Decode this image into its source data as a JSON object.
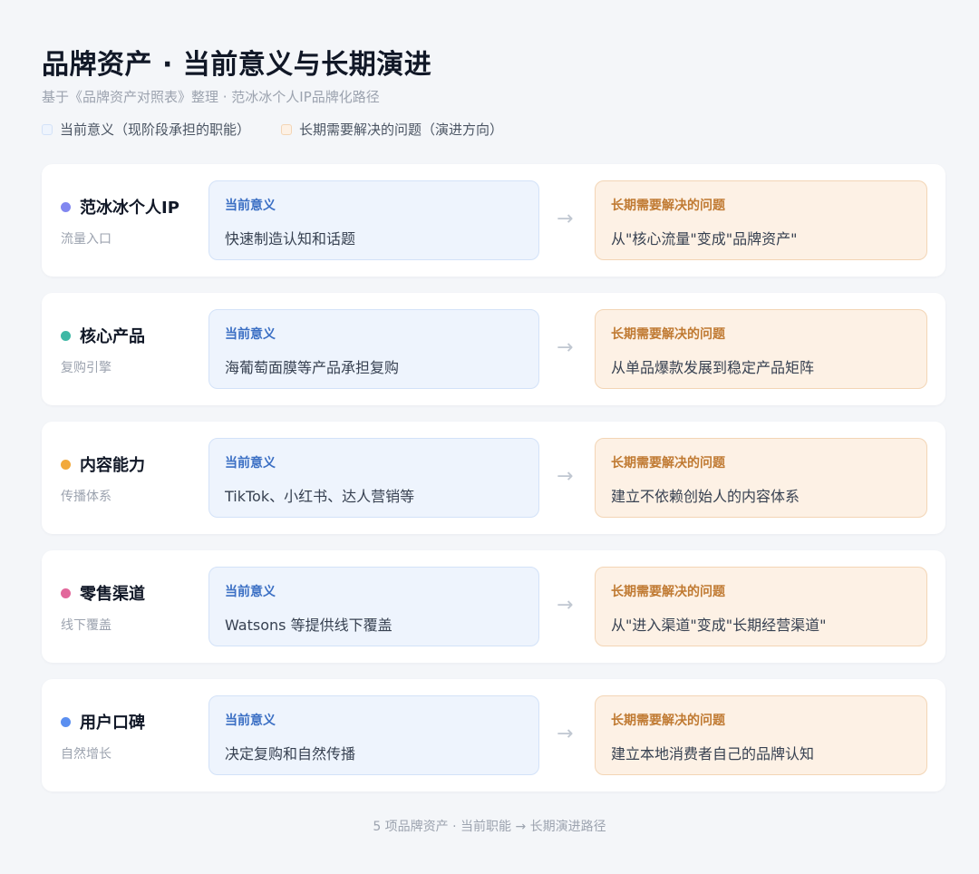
{
  "header": {
    "title": "品牌资产 · 当前意义与长期演进",
    "subtitle": "基于《品牌资产对照表》整理 · 范冰冰个人IP品牌化路径"
  },
  "legend": {
    "current": "当前意义（现阶段承担的职能）",
    "future": "长期需要解决的问题（演进方向）"
  },
  "colors": {
    "current_bg": "#eef4fd",
    "current_label": "#3b6fc4",
    "future_bg": "#fdf1e5",
    "future_label": "#c07a32"
  },
  "rows": [
    {
      "name": "范冰冰个人IP",
      "sub": "流量入口",
      "dot_color": "#8187f0",
      "current_label": "当前意义",
      "current_text": "快速制造认知和话题",
      "arrow": "→",
      "future_label": "长期需要解决的问题",
      "future_text": "从\"核心流量\"变成\"品牌资产\""
    },
    {
      "name": "核心产品",
      "sub": "复购引擎",
      "dot_color": "#3fb8a5",
      "current_label": "当前意义",
      "current_text": "海葡萄面膜等产品承担复购",
      "arrow": "→",
      "future_label": "长期需要解决的问题",
      "future_text": "从单品爆款发展到稳定产品矩阵"
    },
    {
      "name": "内容能力",
      "sub": "传播体系",
      "dot_color": "#f2a93b",
      "current_label": "当前意义",
      "current_text": "TikTok、小红书、达人营销等",
      "arrow": "→",
      "future_label": "长期需要解决的问题",
      "future_text": "建立不依赖创始人的内容体系"
    },
    {
      "name": "零售渠道",
      "sub": "线下覆盖",
      "dot_color": "#e2679b",
      "current_label": "当前意义",
      "current_text": "Watsons 等提供线下覆盖",
      "arrow": "→",
      "future_label": "长期需要解决的问题",
      "future_text": "从\"进入渠道\"变成\"长期经营渠道\""
    },
    {
      "name": "用户口碑",
      "sub": "自然增长",
      "dot_color": "#5b8ff0",
      "current_label": "当前意义",
      "current_text": "决定复购和自然传播",
      "arrow": "→",
      "future_label": "长期需要解决的问题",
      "future_text": "建立本地消费者自己的品牌认知"
    }
  ],
  "footer": "5 项品牌资产 · 当前职能 → 长期演进路径"
}
